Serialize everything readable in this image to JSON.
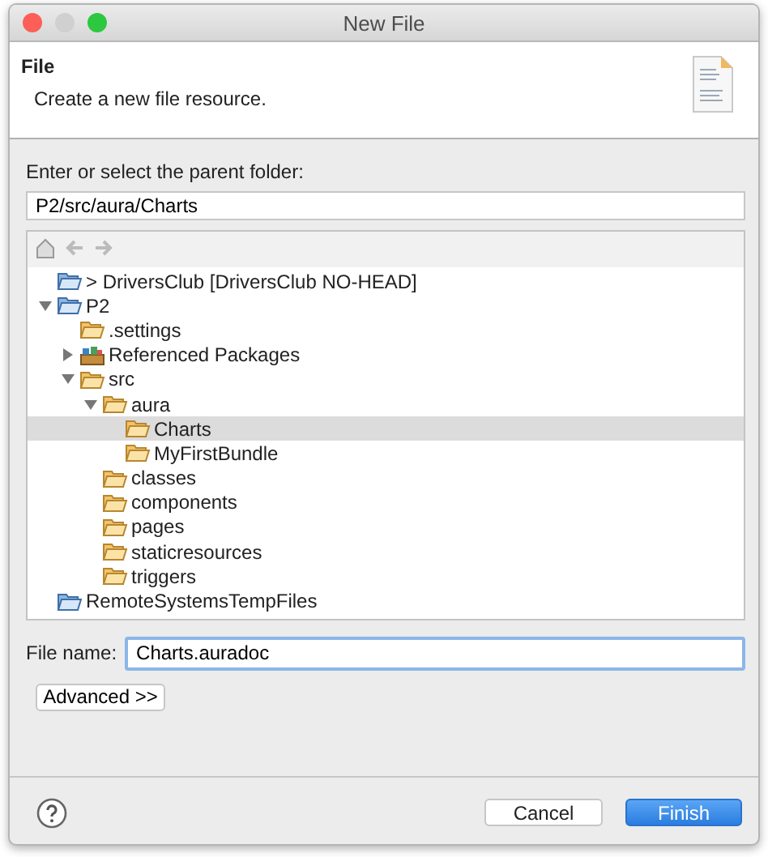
{
  "window": {
    "title": "New File"
  },
  "header": {
    "title": "File",
    "description": "Create a new file resource."
  },
  "parent_folder": {
    "label": "Enter or select the parent folder:",
    "value": "P2/src/aura/Charts"
  },
  "tree": [
    {
      "name": "> DriversClub [DriversClub NO-HEAD]",
      "kind": "project",
      "selected": false
    },
    {
      "name": "P2",
      "kind": "project",
      "expanded": true,
      "selected": false,
      "children": [
        {
          "name": ".settings",
          "kind": "folder",
          "selected": false
        },
        {
          "name": "Referenced Packages",
          "kind": "package",
          "expanded": false,
          "selected": false
        },
        {
          "name": "src",
          "kind": "folder",
          "expanded": true,
          "selected": false,
          "children": [
            {
              "name": "aura",
              "kind": "folder",
              "expanded": true,
              "selected": false,
              "children": [
                {
                  "name": "Charts",
                  "kind": "folder",
                  "selected": true
                },
                {
                  "name": "MyFirstBundle",
                  "kind": "folder",
                  "selected": false
                }
              ]
            },
            {
              "name": "classes",
              "kind": "folder",
              "selected": false
            },
            {
              "name": "components",
              "kind": "folder",
              "selected": false
            },
            {
              "name": "pages",
              "kind": "folder",
              "selected": false
            },
            {
              "name": "staticresources",
              "kind": "folder",
              "selected": false
            },
            {
              "name": "triggers",
              "kind": "folder",
              "selected": false
            }
          ]
        }
      ]
    },
    {
      "name": "RemoteSystemsTempFiles",
      "kind": "project",
      "selected": false
    }
  ],
  "file_name": {
    "label": "File name:",
    "value": "Charts.auradoc"
  },
  "advanced_button": "Advanced >>",
  "buttons": [
    {
      "label": "Cancel",
      "kind": "secondary"
    },
    {
      "label": "Finish",
      "kind": "primary"
    }
  ]
}
